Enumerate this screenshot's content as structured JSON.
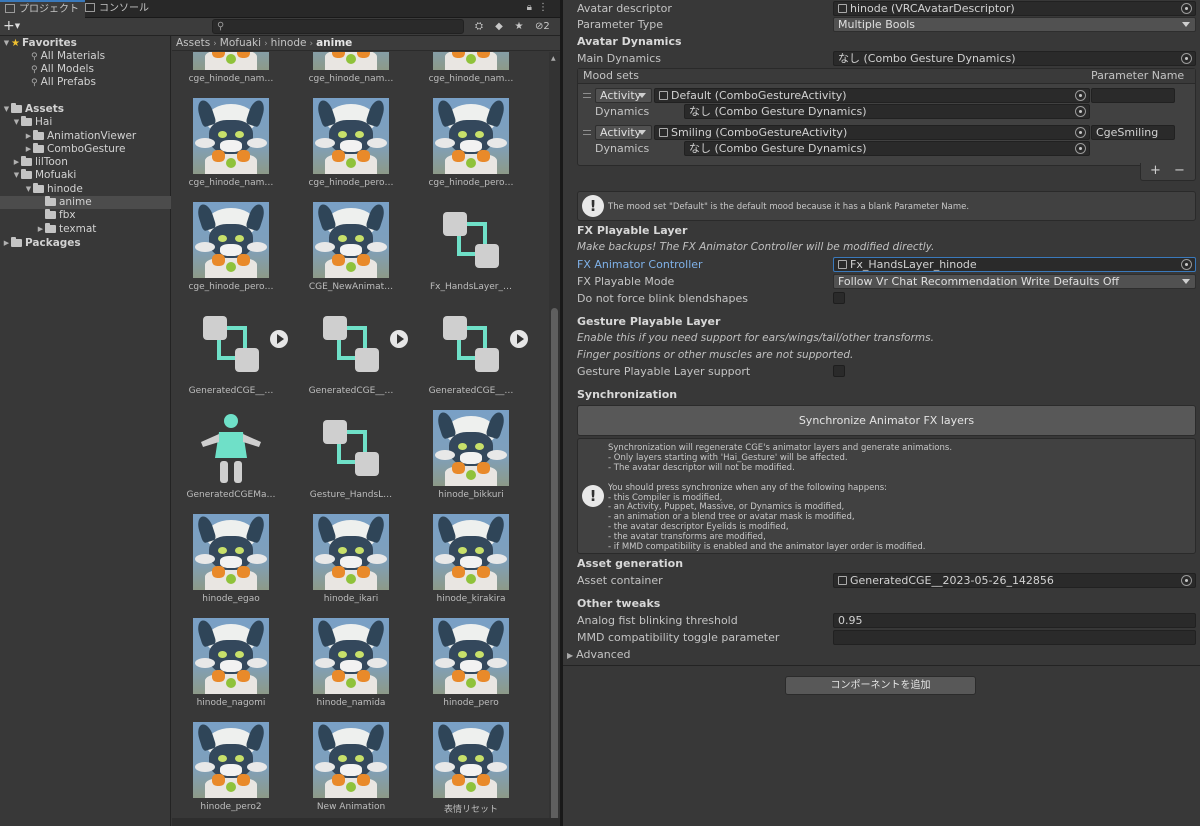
{
  "project": {
    "tabs": [
      {
        "label": "プロジェクト",
        "icon": "folder-icon"
      },
      {
        "label": "コンソール",
        "icon": "console-icon"
      }
    ],
    "toolbar": {
      "add_label": "+",
      "search_placeholder": "",
      "hidden_count": "2"
    },
    "tree": [
      {
        "label": "Favorites",
        "type": "favorites"
      },
      {
        "label": "All Materials",
        "type": "search"
      },
      {
        "label": "All Models",
        "type": "search"
      },
      {
        "label": "All Prefabs",
        "type": "search"
      },
      {
        "label": "Assets",
        "type": "root"
      },
      {
        "label": "Hai",
        "type": "folder"
      },
      {
        "label": "AnimationViewer",
        "type": "folder"
      },
      {
        "label": "ComboGesture",
        "type": "folder"
      },
      {
        "label": "lilToon",
        "type": "folder"
      },
      {
        "label": "Mofuaki",
        "type": "folder"
      },
      {
        "label": "hinode",
        "type": "folder"
      },
      {
        "label": "anime",
        "type": "folder",
        "selected": true
      },
      {
        "label": "fbx",
        "type": "folder"
      },
      {
        "label": "texmat",
        "type": "folder"
      },
      {
        "label": "Packages",
        "type": "root"
      }
    ],
    "breadcrumb": [
      "Assets",
      "Mofuaki",
      "hinode",
      "anime"
    ],
    "assets": [
      {
        "label": "cge_hinode_nam…",
        "kind": "face"
      },
      {
        "label": "cge_hinode_nam…",
        "kind": "face"
      },
      {
        "label": "cge_hinode_nam…",
        "kind": "face"
      },
      {
        "label": "cge_hinode_nam…",
        "kind": "face"
      },
      {
        "label": "cge_hinode_pero…",
        "kind": "face"
      },
      {
        "label": "cge_hinode_pero…",
        "kind": "face"
      },
      {
        "label": "cge_hinode_pero…",
        "kind": "face"
      },
      {
        "label": "CGE_NewAnimat…",
        "kind": "face"
      },
      {
        "label": "Fx_HandsLayer_…",
        "kind": "controller"
      },
      {
        "label": "GeneratedCGE__…",
        "kind": "controller-play"
      },
      {
        "label": "GeneratedCGE__…",
        "kind": "controller-play"
      },
      {
        "label": "GeneratedCGE__…",
        "kind": "controller-play"
      },
      {
        "label": "GeneratedCGEMa…",
        "kind": "avatar-mask"
      },
      {
        "label": "Gesture_HandsL…",
        "kind": "controller"
      },
      {
        "label": "hinode_bikkuri",
        "kind": "face"
      },
      {
        "label": "hinode_egao",
        "kind": "face"
      },
      {
        "label": "hinode_ikari",
        "kind": "face"
      },
      {
        "label": "hinode_kirakira",
        "kind": "face"
      },
      {
        "label": "hinode_nagomi",
        "kind": "face"
      },
      {
        "label": "hinode_namida",
        "kind": "face"
      },
      {
        "label": "hinode_pero",
        "kind": "face"
      },
      {
        "label": "hinode_pero2",
        "kind": "face"
      },
      {
        "label": "New Animation",
        "kind": "face"
      },
      {
        "label": "表情リセット",
        "kind": "face"
      }
    ]
  },
  "inspector": {
    "avatar_descriptor_label": "Avatar descriptor",
    "avatar_descriptor_value": "hinode (VRCAvatarDescriptor)",
    "parameter_type_label": "Parameter Type",
    "parameter_type_value": "Multiple Bools",
    "avatar_dynamics_header": "Avatar Dynamics",
    "main_dynamics_label": "Main Dynamics",
    "main_dynamics_value": "なし (Combo Gesture Dynamics)",
    "mood_sets_label": "Mood sets",
    "parameter_name_header": "Parameter Name",
    "mood_sets": [
      {
        "mode": "Activity",
        "activity": "Default (ComboGestureActivity)",
        "param": "",
        "dynamics_label": "Dynamics",
        "dynamics": "なし (Combo Gesture Dynamics)"
      },
      {
        "mode": "Activity",
        "activity": "Smiling (ComboGestureActivity)",
        "param": "CgeSmiling",
        "dynamics_label": "Dynamics",
        "dynamics": "なし (Combo Gesture Dynamics)"
      }
    ],
    "add_symbol": "+",
    "remove_symbol": "−",
    "default_mood_help": "The mood set \"Default\" is the default mood because it has a blank Parameter Name.",
    "fx_header": "FX Playable Layer",
    "fx_warning": "Make backups! The FX Animator Controller will be modified directly.",
    "fx_controller_label": "FX Animator Controller",
    "fx_controller_value": "Fx_HandsLayer_hinode",
    "fx_mode_label": "FX Playable Mode",
    "fx_mode_value": "Follow Vr Chat Recommendation Write Defaults Off",
    "blink_label": "Do not force blink blendshapes",
    "gesture_header": "Gesture Playable Layer",
    "gesture_note1": "Enable this if you need support for ears/wings/tail/other transforms.",
    "gesture_note2": "Finger positions or other muscles are not supported.",
    "gesture_support_label": "Gesture Playable Layer support",
    "sync_header": "Synchronization",
    "sync_button": "Synchronize Animator FX layers",
    "sync_help": [
      "Synchronization will regenerate CGE's animator layers and generate animations.",
      "- Only layers starting with 'Hai_Gesture' will be affected.",
      "- The avatar descriptor will not be modified.",
      "",
      "You should press synchronize when any of the following happens:",
      "- this Compiler is modified,",
      "- an Activity, Puppet, Massive, or Dynamics is modified,",
      "- an animation or a blend tree or avatar mask is modified,",
      "- the avatar descriptor Eyelids is modified,",
      "- the avatar transforms are modified,",
      "- if MMD compatibility is enabled and the animator layer order is modified."
    ],
    "asset_gen_header": "Asset generation",
    "asset_container_label": "Asset container",
    "asset_container_value": "GeneratedCGE__2023-05-26_142856",
    "other_header": "Other tweaks",
    "analog_label": "Analog fist blinking threshold",
    "analog_value": "0.95",
    "mmd_label": "MMD compatibility toggle parameter",
    "mmd_value": "",
    "advanced_label": "Advanced",
    "add_component_button": "コンポーネントを追加"
  }
}
